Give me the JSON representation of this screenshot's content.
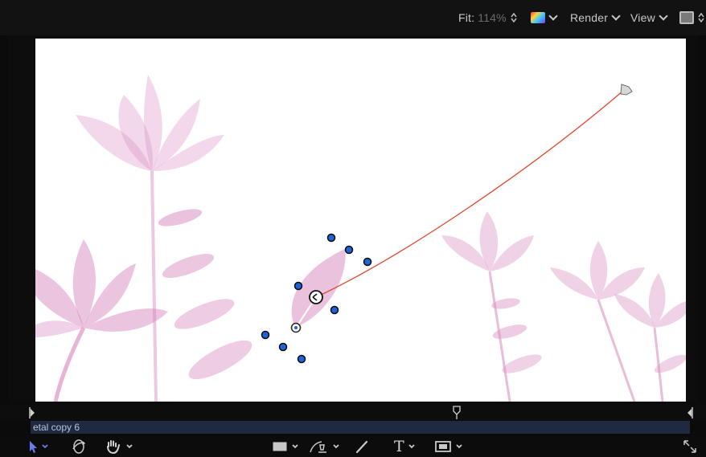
{
  "toolbar": {
    "fit_label": "Fit:",
    "fit_value": "114%",
    "render_label": "Render",
    "view_label": "View"
  },
  "timeline": {
    "layer_name": "etal copy 6"
  },
  "tools": {
    "text_tool_glyph": "T"
  },
  "colors": {
    "accent": "#6b7cf2",
    "motion_path": "#e0452e",
    "handle": "#1f63d8",
    "flower": "#e2a8cf"
  }
}
